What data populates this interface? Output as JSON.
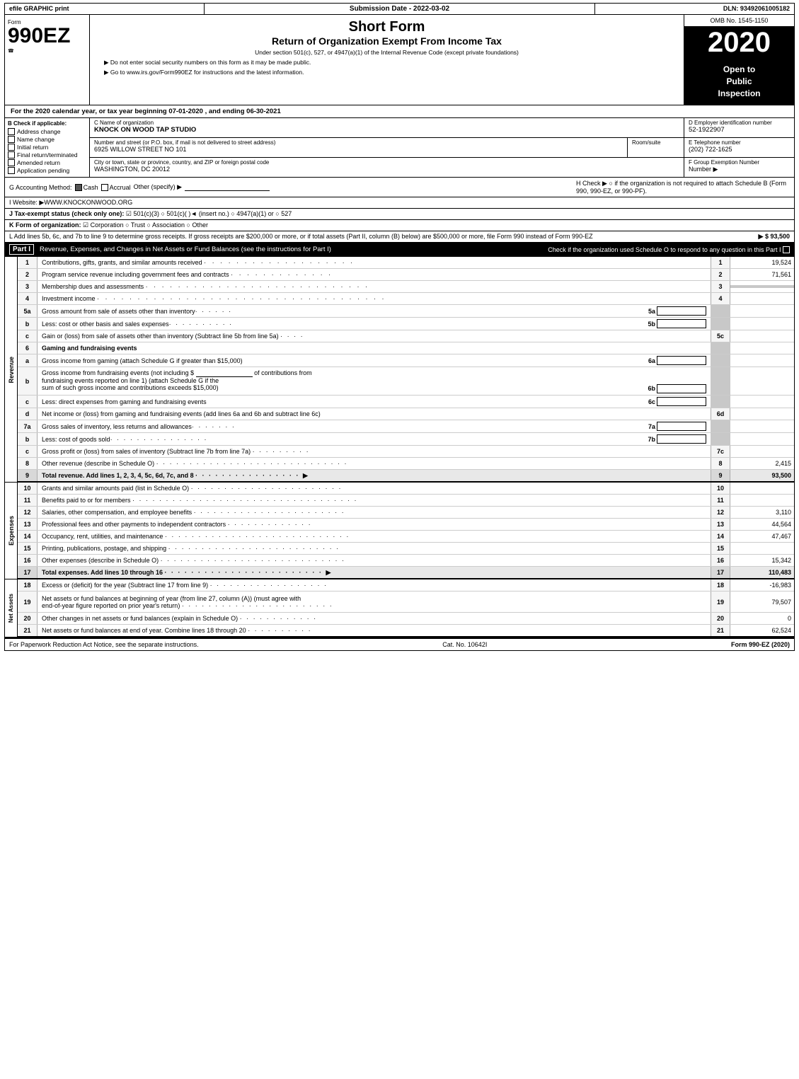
{
  "header": {
    "efile": "efile GRAPHIC print",
    "submission": "Submission Date - 2022-03-02",
    "dln": "DLN: 93492061005182",
    "form_number": "990EZ",
    "short_form": "Short Form",
    "return_title": "Return of Organization Exempt From Income Tax",
    "under_section": "Under section 501(c), 527, or 4947(a)(1) of the Internal Revenue Code (except private foundations)",
    "do_not_enter": "▶ Do not enter social security numbers on this form as it may be made public.",
    "go_to": "▶ Go to www.irs.gov/Form990EZ for instructions and the latest information.",
    "omb": "OMB No. 1545-1150",
    "year": "2020",
    "open_line1": "Open to",
    "open_line2": "Public",
    "open_line3": "Inspection"
  },
  "tax_year": {
    "text": "For the 2020 calendar year, or tax year beginning 07-01-2020 , and ending 06-30-2021"
  },
  "checkboxes": {
    "b_label": "B Check if applicable:",
    "address_change": "Address change",
    "name_change": "Name change",
    "initial_return": "Initial return",
    "final_return": "Final return/terminated",
    "amended_return": "Amended return",
    "application_pending": "Application pending",
    "address_checked": false,
    "name_checked": false,
    "initial_checked": false,
    "final_checked": false,
    "amended_checked": false,
    "application_checked": false
  },
  "org": {
    "c_label": "C Name of organization",
    "name": "KNOCK ON WOOD TAP STUDIO",
    "d_label": "D Employer identification number",
    "ein": "52-1922907",
    "address_label": "Number and street (or P.O. box, if mail is not delivered to street address)",
    "address": "6925 WILLOW STREET NO 101",
    "room_label": "Room/suite",
    "room": "",
    "e_label": "E Telephone number",
    "phone": "(202) 722-1625",
    "city_label": "City or town, state or province, country, and ZIP or foreign postal code",
    "city": "WASHINGTON, DC  20012",
    "f_label": "F Group Exemption Number",
    "f_arrow": "▶"
  },
  "accounting": {
    "g_label": "G Accounting Method:",
    "cash_label": "Cash",
    "cash_checked": true,
    "accrual_label": "Accrual",
    "accrual_checked": false,
    "other_label": "Other (specify) ▶",
    "h_label": "H Check ▶",
    "h_text": "○ if the organization is not required to attach Schedule B (Form 990, 990-EZ, or 990-PF)."
  },
  "website": {
    "i_label": "I Website: ▶WWW.KNOCKONWOOD.ORG"
  },
  "tax_status": {
    "j_label": "J Tax-exempt status (check only one):",
    "j_options": "☑ 501(c)(3)  ○ 501(c)(  )◄ (insert no.)  ○ 4947(a)(1) or  ○ 527"
  },
  "form_org": {
    "k_label": "K Form of organization:",
    "k_options": "☑ Corporation   ○ Trust   ○ Association   ○ Other"
  },
  "gross_receipts": {
    "l_text": "L Add lines 5b, 6c, and 7b to line 9 to determine gross receipts. If gross receipts are $200,000 or more, or if total assets (Part II, column (B) below) are $500,000 or more, file Form 990 instead of Form 990-EZ",
    "l_value": "▶ $ 93,500"
  },
  "part1": {
    "header": "Part I",
    "title": "Revenue, Expenses, and Changes in Net Assets or Fund Balances (see the instructions for Part I)",
    "schedule_o_check": "Check if the organization used Schedule O to respond to any question in this Part I",
    "lines": [
      {
        "num": "1",
        "desc": "Contributions, gifts, grants, and similar amounts received",
        "value": "19,524"
      },
      {
        "num": "2",
        "desc": "Program service revenue including government fees and contracts",
        "value": "71,561"
      },
      {
        "num": "3",
        "desc": "Membership dues and assessments",
        "value": ""
      },
      {
        "num": "4",
        "desc": "Investment income",
        "value": ""
      },
      {
        "num": "5a",
        "desc": "Gross amount from sale of assets other than inventory",
        "sub": "5a",
        "value": ""
      },
      {
        "num": "b",
        "desc": "Less: cost or other basis and sales expenses",
        "sub": "5b",
        "value": ""
      },
      {
        "num": "c",
        "desc": "Gain or (loss) from sale of assets other than inventory (Subtract line 5b from line 5a)",
        "value": "",
        "line_num": "5c"
      },
      {
        "num": "6",
        "desc": "Gaming and fundraising events",
        "value": ""
      },
      {
        "num": "a",
        "desc": "Gross income from gaming (attach Schedule G if greater than $15,000)",
        "sub": "6a",
        "value": ""
      },
      {
        "num": "b",
        "desc": "Gross income from fundraising events (not including $_____ of contributions from fundraising events reported on line 1) (attach Schedule G if the sum of such gross income and contributions exceeds $15,000)",
        "sub": "6b",
        "value": ""
      },
      {
        "num": "c",
        "desc": "Less: direct expenses from gaming and fundraising events",
        "sub": "6c",
        "value": ""
      },
      {
        "num": "d",
        "desc": "Net income or (loss) from gaming and fundraising events (add lines 6a and 6b and subtract line 6c)",
        "value": "",
        "line_num": "6d"
      },
      {
        "num": "7a",
        "desc": "Gross sales of inventory, less returns and allowances",
        "sub": "7a",
        "value": ""
      },
      {
        "num": "b",
        "desc": "Less: cost of goods sold",
        "sub": "7b",
        "value": ""
      },
      {
        "num": "c",
        "desc": "Gross profit or (loss) from sales of inventory (Subtract line 7b from line 7a)",
        "value": "",
        "line_num": "7c"
      },
      {
        "num": "8",
        "desc": "Other revenue (describe in Schedule O)",
        "value": "2,415"
      },
      {
        "num": "9",
        "desc": "Total revenue. Add lines 1, 2, 3, 4, 5c, 6d, 7c, and 8",
        "value": "93,500",
        "bold": true
      }
    ]
  },
  "expenses": {
    "lines": [
      {
        "num": "10",
        "desc": "Grants and similar amounts paid (list in Schedule O)",
        "value": ""
      },
      {
        "num": "11",
        "desc": "Benefits paid to or for members",
        "value": ""
      },
      {
        "num": "12",
        "desc": "Salaries, other compensation, and employee benefits",
        "value": "3,110"
      },
      {
        "num": "13",
        "desc": "Professional fees and other payments to independent contractors",
        "value": "44,564"
      },
      {
        "num": "14",
        "desc": "Occupancy, rent, utilities, and maintenance",
        "value": "47,467"
      },
      {
        "num": "15",
        "desc": "Printing, publications, postage, and shipping",
        "value": ""
      },
      {
        "num": "16",
        "desc": "Other expenses (describe in Schedule O)",
        "value": "15,342"
      },
      {
        "num": "17",
        "desc": "Total expenses. Add lines 10 through 16",
        "value": "110,483",
        "bold": true
      }
    ]
  },
  "net_assets": {
    "lines": [
      {
        "num": "18",
        "desc": "Excess or (deficit) for the year (Subtract line 17 from line 9)",
        "value": "-16,983"
      },
      {
        "num": "19",
        "desc": "Net assets or fund balances at beginning of year (from line 27, column (A)) (must agree with end-of-year figure reported on prior year's return)",
        "value": "79,507"
      },
      {
        "num": "20",
        "desc": "Other changes in net assets or fund balances (explain in Schedule O)",
        "value": "0"
      },
      {
        "num": "21",
        "desc": "Net assets or fund balances at end of year. Combine lines 18 through 20",
        "value": "62,524"
      }
    ]
  },
  "footer": {
    "paperwork": "For Paperwork Reduction Act Notice, see the separate instructions.",
    "cat_no": "Cat. No. 10642I",
    "form_ref": "Form 990-EZ (2020)"
  }
}
